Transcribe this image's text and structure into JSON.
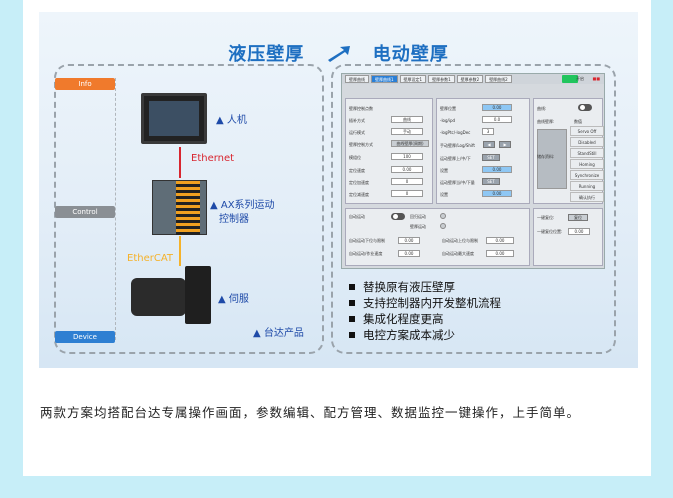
{
  "title": {
    "left": "液压壁厚",
    "right": "电动壁厚"
  },
  "layers": {
    "info": "Info",
    "control": "Control",
    "device": "Device"
  },
  "labels": {
    "hmi": "▲ 人机",
    "ethernet": "Ethernet",
    "ax_line1": "▲ AX系列运动",
    "ax_line2": "控制器",
    "ethercat": "EtherCAT",
    "servo": "▲ 伺服",
    "delta": "▲ 台达产品"
  },
  "screen": {
    "tabs": [
      "壁厚曲线",
      "壁厚曲线1",
      "壁厚设定1",
      "壁厚参数1",
      "壁厚参数2",
      "壁厚曲线2"
    ],
    "run_label": "开启",
    "left_rows": [
      "壁厚控制点数",
      "插补方式",
      "运行模式",
      "壁厚控制方式",
      "模组位",
      "定位速度",
      "定位加速度",
      "定位减速度"
    ],
    "left_values": [
      "",
      "曲线",
      "手动",
      "曲线壁厚(周期)",
      "100",
      "0.00",
      "0",
      "0"
    ],
    "mid_rows": [
      "壁厚位置",
      "-log/ipd",
      "-logPtc/-logDec",
      "手动壁厚/Log/Shift",
      "运动壁厚上/中/下",
      "设置",
      "运动壁厚当/中/下量",
      "设置"
    ],
    "mid_values": [
      "0.00",
      "0.0",
      "3",
      "",
      "SET",
      "0.00",
      "SET",
      "0.00"
    ],
    "right_labels": [
      "曲线:",
      "曲线壁厚:",
      "储存资料:"
    ],
    "right_values": [
      "1",
      "数值"
    ],
    "right_options": [
      "Servo Off",
      "Disabled",
      "StandStill",
      "Homing",
      "Synchronize",
      "Running",
      "确认执行"
    ],
    "bottom_rows": [
      "自动运动",
      "回归运动",
      "壁厚运动",
      "自动运动下位与限制",
      "自动运动上位与限制",
      "自动运动/作业速度",
      "自动运动最大速度"
    ],
    "bottom_values": [
      "0.00",
      "0.00",
      "0.00",
      "0.00"
    ],
    "br_labels": [
      "一键复位:",
      "一键复位位置:"
    ],
    "br_values": [
      "复位",
      "0.00"
    ]
  },
  "bullets": [
    "替换原有液压壁厚",
    "支持控制器内开发整机流程",
    "集成化程度更高",
    "电控方案成本减少"
  ],
  "description": "两款方案均搭配台达专属操作画面，参数编辑、配方管理、数据监控一键操作，上手简单。"
}
